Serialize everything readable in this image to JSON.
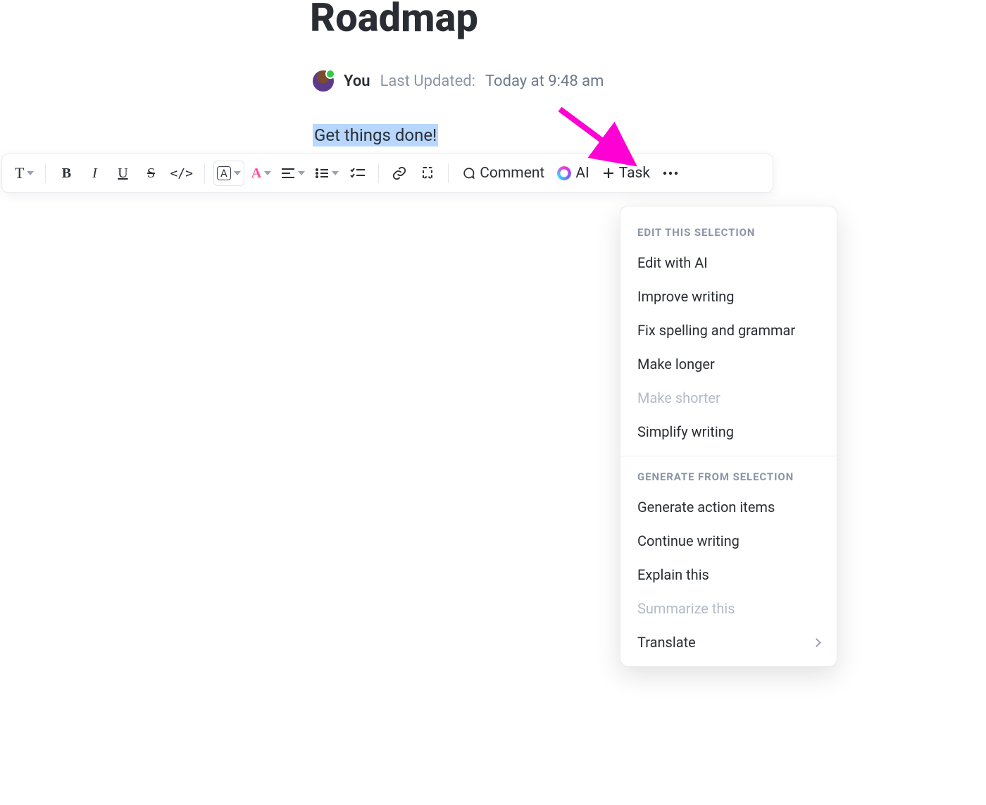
{
  "page": {
    "title": "Roadmap",
    "author": "You",
    "last_updated_label": "Last Updated:",
    "last_updated_value": "Today at 9:48 am",
    "selected_text": "Get things done!"
  },
  "toolbar": {
    "text_style": "T",
    "bold": "B",
    "italic": "I",
    "underline": "U",
    "strike": "S",
    "code": "</>",
    "highlight": "A",
    "text_color": "A",
    "comment": "Comment",
    "ai": "AI",
    "task": "Task",
    "more": "⋯"
  },
  "ai_menu": {
    "section1_header": "Edit this selection",
    "edit_with_ai": "Edit with AI",
    "improve_writing": "Improve writing",
    "fix_spelling": "Fix spelling and grammar",
    "make_longer": "Make longer",
    "make_shorter": "Make shorter",
    "simplify": "Simplify writing",
    "section2_header": "Generate from selection",
    "generate_action_items": "Generate action items",
    "continue_writing": "Continue writing",
    "explain_this": "Explain this",
    "summarize_this": "Summarize this",
    "translate": "Translate"
  },
  "colors": {
    "arrow": "#ff00d4"
  }
}
